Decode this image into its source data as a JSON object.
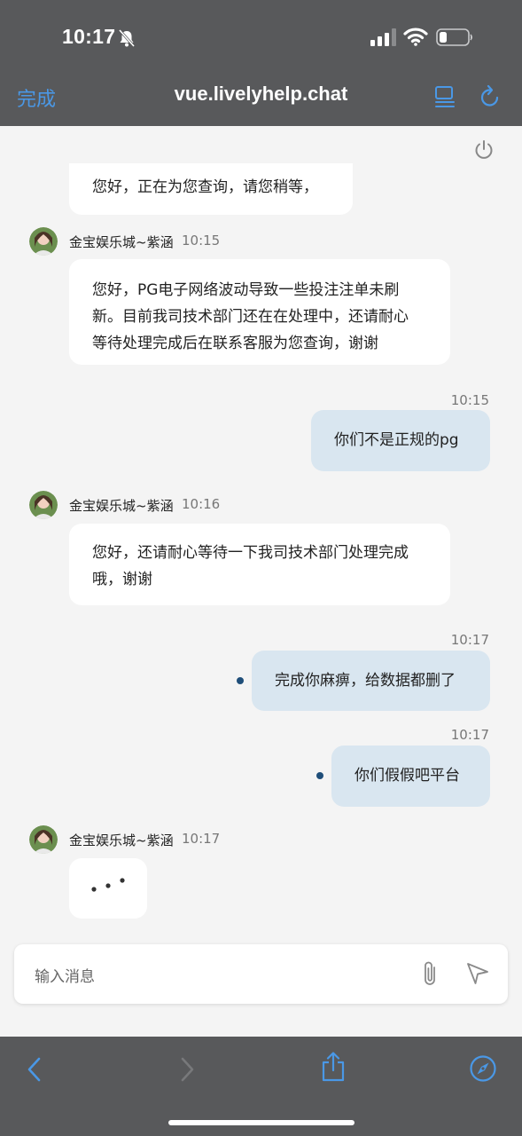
{
  "status_bar": {
    "time": "10:17"
  },
  "browser": {
    "done_label": "完成",
    "url": "vue.livelyhelp.chat"
  },
  "messages": [
    {
      "text": "您好，正在为您查询，请您稍等，"
    },
    {
      "agent": "金宝娱乐城~紫涵",
      "time": "10:15",
      "lines": [
        "您好，PG电子网络波动导致一些投注注单未刷",
        "新。目前我司技术部门还在在处理中，还请耐心",
        "等待处理完成后在联系客服为您查询，谢谢"
      ]
    },
    {
      "time": "10:15",
      "text": "你们不是正规的pg"
    },
    {
      "agent": "金宝娱乐城~紫涵",
      "time": "10:16",
      "lines": [
        "您好，还请耐心等待一下我司技术部门处理完成",
        "哦，谢谢"
      ]
    },
    {
      "time": "10:17",
      "text": "完成你麻痹，给数据都删了"
    },
    {
      "time": "10:17",
      "text": "你们假假吧平台"
    },
    {
      "agent": "金宝娱乐城~紫涵",
      "time": "10:17",
      "typing": true
    }
  ],
  "input": {
    "placeholder": "输入消息"
  },
  "colors": {
    "accent": "#4a98e6",
    "bar": "#58595b",
    "user_bubble": "#d9e6f0",
    "unread_dot": "#1f4e79"
  },
  "icons": [
    "bell-slash-icon",
    "signal-icon",
    "wifi-icon",
    "battery-icon",
    "reader-icon",
    "reload-icon",
    "power-icon",
    "paperclip-icon",
    "send-icon",
    "back-icon",
    "forward-icon",
    "share-icon",
    "compass-icon"
  ]
}
